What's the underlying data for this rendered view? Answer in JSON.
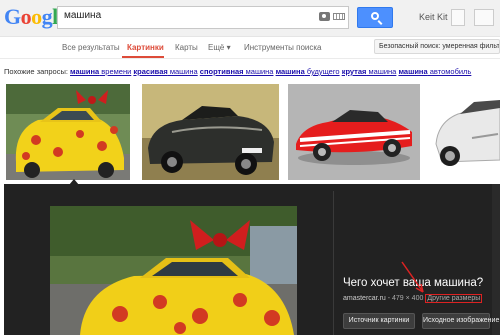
{
  "header": {
    "logo": [
      "G",
      "o",
      "o",
      "g",
      "l",
      "e"
    ],
    "logo_colors": [
      "#4285f4",
      "#ea4335",
      "#fbbc05",
      "#4285f4",
      "#34a853",
      "#ea4335"
    ],
    "search_value": "машина",
    "user_name": "Keit Kit"
  },
  "nav": {
    "items": [
      "Все результаты",
      "Картинки",
      "Карты",
      "Ещё",
      "Инструменты поиска"
    ],
    "more_arrow": "▾",
    "safe_search": "Безопасный поиск: умеренная фильтрация"
  },
  "related": {
    "prefix": "Похожие запросы:",
    "queries": [
      {
        "bold": "машина",
        "rest": " времени"
      },
      {
        "bold": "красивая",
        "rest": " машина"
      },
      {
        "bold": "спортивная",
        "rest": " машина"
      },
      {
        "bold": "машина",
        "rest": " будущего"
      },
      {
        "bold": "крутая",
        "rest": " машина"
      },
      {
        "bold": "машина",
        "rest": " автомобиль"
      }
    ]
  },
  "preview": {
    "title": "Чего хочет ваша машина?",
    "domain": "amastercar.ru",
    "dims": " - 479 × 400",
    "other_sizes": "Другие размеры",
    "btn_source": "Источник картинки",
    "btn_original": "Исходное изображение"
  },
  "colors": {
    "accent_red": "#dd4b39",
    "search_blue": "#4d90fe",
    "link": "#1a0dab",
    "annotation": "#dd2222"
  }
}
